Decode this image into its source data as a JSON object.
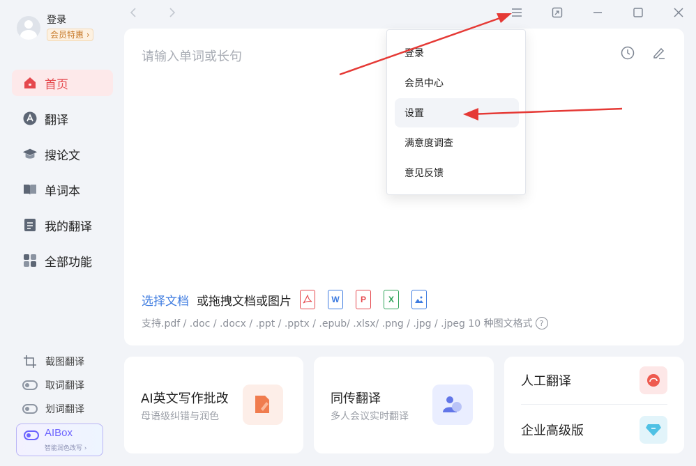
{
  "user": {
    "name": "登录",
    "vip_label": "会员特惠 ›"
  },
  "nav": {
    "home": "首页",
    "translate": "翻译",
    "papers": "搜论文",
    "wordbook": "单词本",
    "my_translations": "我的翻译",
    "all_features": "全部功能"
  },
  "tools": {
    "screenshot": "截图翻译",
    "pick_word": "取词翻译",
    "select_word": "划词翻译"
  },
  "aibox": {
    "title": "AIBox",
    "subtitle": "智能润色改写 ›"
  },
  "main": {
    "placeholder": "请输入单词或长句",
    "select_doc": "选择文档",
    "drag_text": "或拖拽文档或图片",
    "formats": "支持.pdf / .doc / .docx / .ppt / .pptx / .epub/ .xlsx/ .png / .jpg / .jpeg  10 种图文格式",
    "help": "?"
  },
  "file_types": {
    "word": "W",
    "ppt": "P",
    "excel": "X"
  },
  "cards": {
    "ai_writing": {
      "title": "AI英文写作批改",
      "subtitle": "母语级纠错与润色"
    },
    "simul": {
      "title": "同传翻译",
      "subtitle": "多人会议实时翻译"
    },
    "human": {
      "title": "人工翻译"
    },
    "enterprise": {
      "title": "企业高级版"
    }
  },
  "menu": {
    "login": "登录",
    "vip_center": "会员中心",
    "settings": "设置",
    "survey": "满意度调查",
    "feedback": "意见反馈"
  },
  "colors": {
    "accent_red": "#e5484d",
    "link_blue": "#3d7be0",
    "annotation_arrow": "#e53935"
  }
}
